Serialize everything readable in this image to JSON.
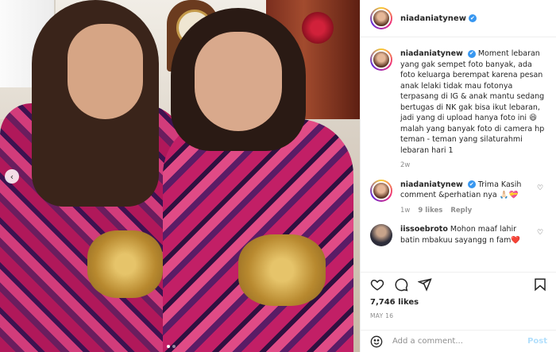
{
  "post": {
    "username": "niadaniatynew",
    "verified": true,
    "caption": "Moment lebaran yang gak sempet foto banyak, ada foto keluarga berempat karena pesan anak lelaki tidak mau fotonya terpasang di IG & anak mantu sedang bertugas di NK gak bisa ikut lebaran, jadi yang di upload hanya foto ini 😆 malah yang banyak foto di camera hp teman - teman yang silaturahmi lebaran hari 1",
    "caption_time": "2w",
    "comments": [
      {
        "username": "niadaniatynew",
        "text": "Trima Kasih comment &perhatian nya 🙏🏻💝",
        "time": "1w",
        "likes": "9 likes",
        "reply": "Reply"
      },
      {
        "username": "iissoebroto",
        "text": "Mohon maaf lahir batin mbakuu sayangg n fam❤️",
        "time": "",
        "likes": "",
        "reply": ""
      }
    ],
    "likes": "7,746 likes",
    "date": "MAY 16",
    "add_comment_placeholder": "Add a comment...",
    "post_button": "Post"
  },
  "icons": {
    "like": "heart-icon",
    "comment": "comment-icon",
    "share": "share-icon",
    "save": "bookmark-icon",
    "emoji": "smile-icon",
    "prev": "chevron-left-icon"
  },
  "carousel": {
    "slides": 2,
    "active": 1
  }
}
